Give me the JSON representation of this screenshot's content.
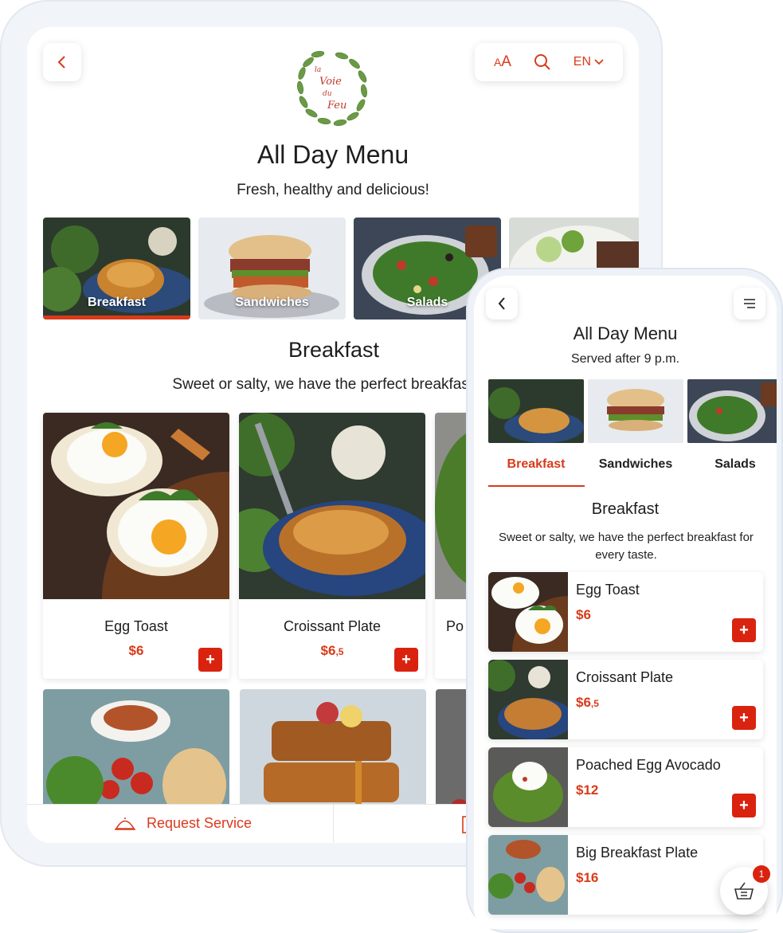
{
  "colors": {
    "accent": "#d93a1b",
    "add_button": "#d9230f"
  },
  "tablet": {
    "toolbar": {
      "text_size_label": "A",
      "text_size_label_large": "A",
      "language": "EN"
    },
    "logo_text": [
      "la",
      "Voie",
      "du",
      "Feu"
    ],
    "title": "All Day Menu",
    "subtitle": "Fresh, healthy and delicious!",
    "categories": [
      {
        "label": "Breakfast",
        "icon": "croissant-photo"
      },
      {
        "label": "Sandwiches",
        "icon": "sandwich-photo"
      },
      {
        "label": "Salads",
        "icon": "salad-photo"
      },
      {
        "label": "",
        "icon": "steak-salad-photo"
      }
    ],
    "section": {
      "title": "Breakfast",
      "description": "Sweet or salty, we have the perfect breakfast for"
    },
    "items": [
      {
        "name": "Egg Toast",
        "price": "$6",
        "add": "+"
      },
      {
        "name": "Croissant Plate",
        "price": "$6",
        "price_cents": ",5",
        "add": "+"
      },
      {
        "name": "Po",
        "price": "",
        "add": ""
      }
    ],
    "footer": {
      "request_service": "Request Service"
    }
  },
  "phone": {
    "title": "All Day Menu",
    "subtitle": "Served after 9 p.m.",
    "tabs": [
      "Breakfast",
      "Sandwiches",
      "Salads"
    ],
    "section": {
      "title": "Breakfast",
      "description": "Sweet or salty, we have the perfect breakfast for every taste."
    },
    "items": [
      {
        "name": "Egg Toast",
        "price": "$6",
        "price_cents": "",
        "add": "+"
      },
      {
        "name": "Croissant Plate",
        "price": "$6",
        "price_cents": ",5",
        "add": "+"
      },
      {
        "name": "Poached Egg Avocado",
        "price": "$12",
        "price_cents": "",
        "add": "+"
      },
      {
        "name": "Big Breakfast Plate",
        "price": "$16",
        "price_cents": "",
        "add": "+"
      }
    ],
    "cart_count": "1"
  }
}
